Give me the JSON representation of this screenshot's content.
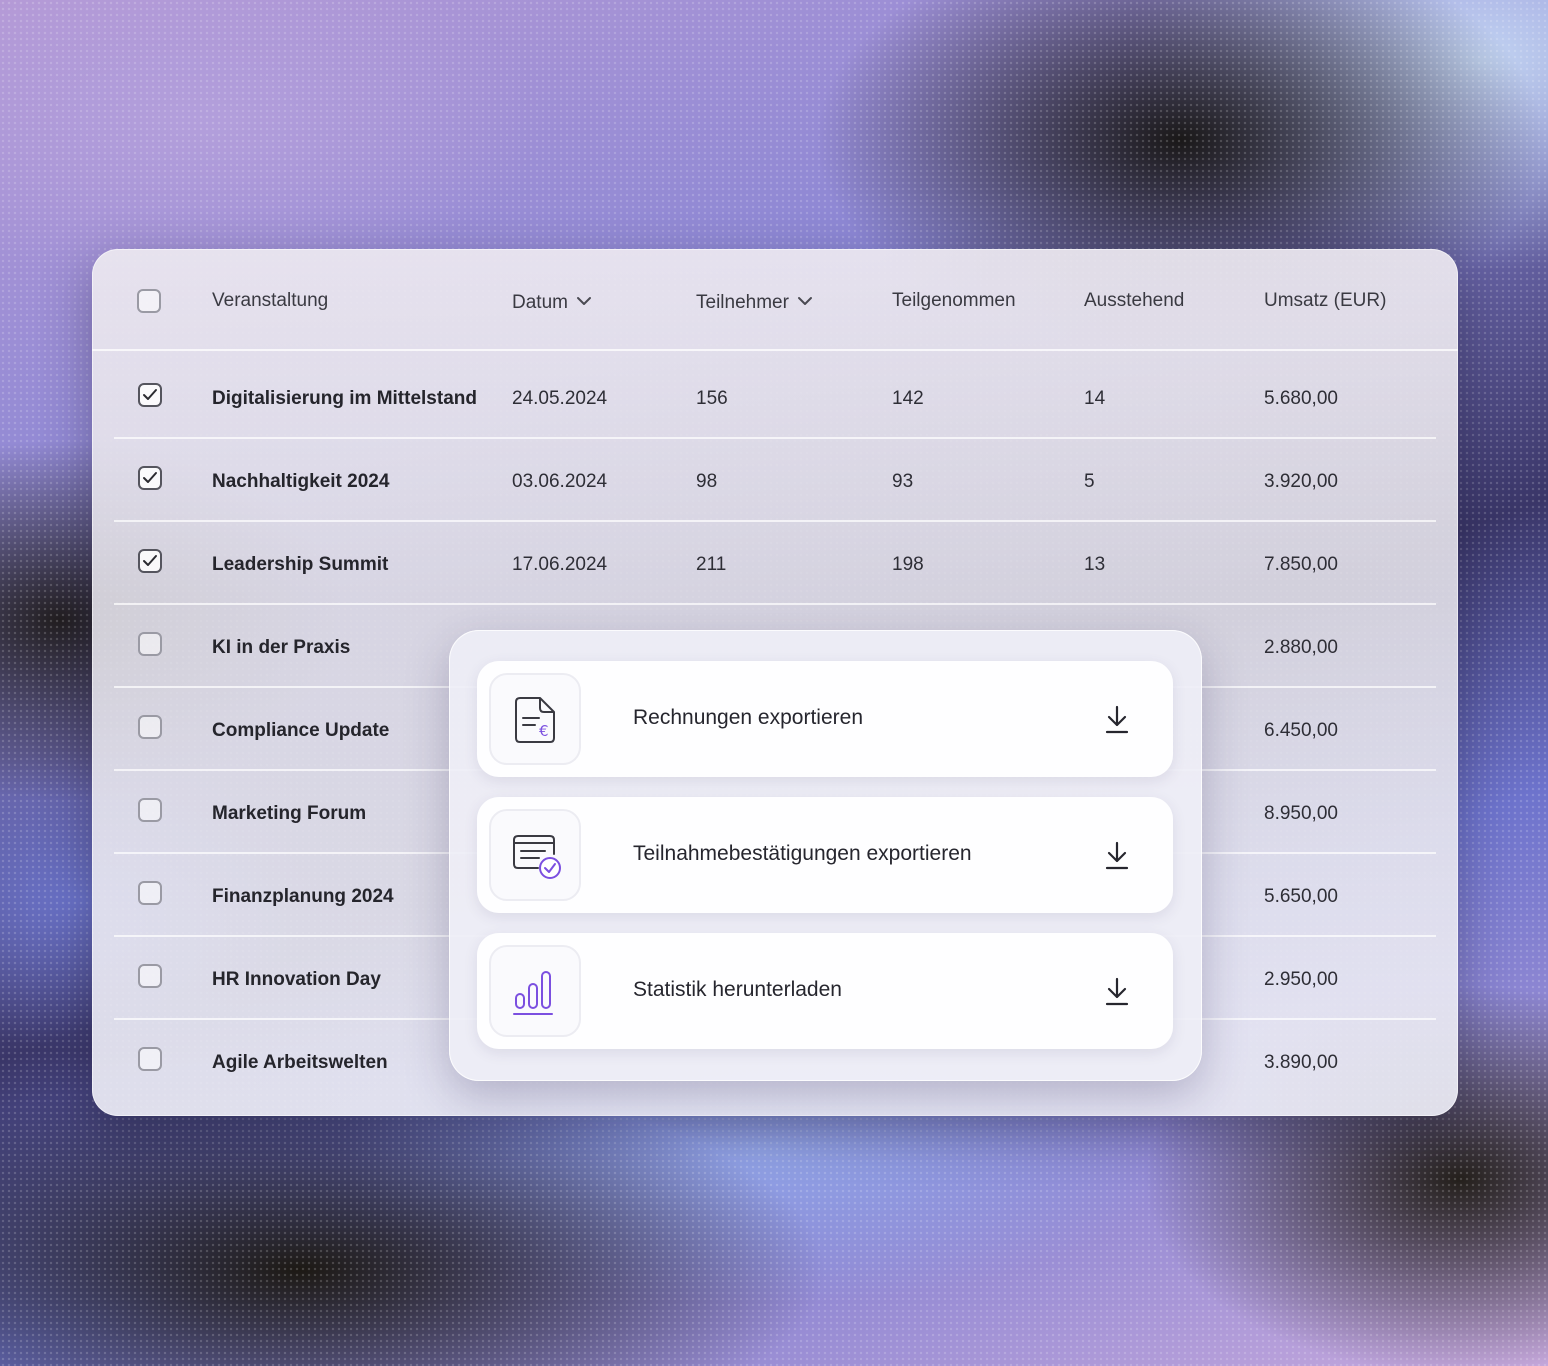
{
  "table": {
    "columns": [
      {
        "label": "Veranstaltung",
        "sortable": false
      },
      {
        "label": "Datum",
        "sortable": true
      },
      {
        "label": "Teilnehmer",
        "sortable": true
      },
      {
        "label": "Teilgenommen",
        "sortable": false
      },
      {
        "label": "Ausstehend",
        "sortable": false
      },
      {
        "label": "Umsatz (EUR)",
        "sortable": false
      }
    ],
    "select_all_checked": false,
    "rows": [
      {
        "checked": true,
        "name": "Digitalisierung im Mittelstand",
        "date": "24.05.2024",
        "participants": "156",
        "attended": "142",
        "pending": "14",
        "revenue": "5.680,00"
      },
      {
        "checked": true,
        "name": "Nachhaltigkeit 2024",
        "date": "03.06.2024",
        "participants": "98",
        "attended": "93",
        "pending": "5",
        "revenue": "3.920,00"
      },
      {
        "checked": true,
        "name": "Leadership Summit",
        "date": "17.06.2024",
        "participants": "211",
        "attended": "198",
        "pending": "13",
        "revenue": "7.850,00"
      },
      {
        "checked": false,
        "name": "KI in der Praxis",
        "date": "",
        "participants": "",
        "attended": "",
        "pending": "",
        "revenue": "2.880,00"
      },
      {
        "checked": false,
        "name": "Compliance Update",
        "date": "",
        "participants": "",
        "attended": "",
        "pending": "",
        "revenue": "6.450,00"
      },
      {
        "checked": false,
        "name": "Marketing Forum",
        "date": "",
        "participants": "",
        "attended": "",
        "pending": "",
        "revenue": "8.950,00"
      },
      {
        "checked": false,
        "name": "Finanzplanung 2024",
        "date": "",
        "participants": "",
        "attended": "",
        "pending": "",
        "revenue": "5.650,00"
      },
      {
        "checked": false,
        "name": "HR Innovation Day",
        "date": "",
        "participants": "",
        "attended": "",
        "pending": "",
        "revenue": "2.950,00"
      },
      {
        "checked": false,
        "name": "Agile Arbeitswelten",
        "date": "",
        "participants": "",
        "attended": "",
        "pending": "",
        "revenue": "3.890,00"
      }
    ]
  },
  "export_menu": {
    "options": [
      {
        "label": "Rechnungen exportieren",
        "icon": "invoice-euro-icon"
      },
      {
        "label": "Teilnahmebestätigungen exportieren",
        "icon": "certificate-check-icon"
      },
      {
        "label": "Statistik herunterladen",
        "icon": "bar-chart-icon"
      }
    ],
    "action_icon": "download-icon"
  },
  "colors": {
    "accent": "#7b4fe0",
    "text_primary": "#25252c",
    "checkbox_border": "#9a9aa4"
  }
}
